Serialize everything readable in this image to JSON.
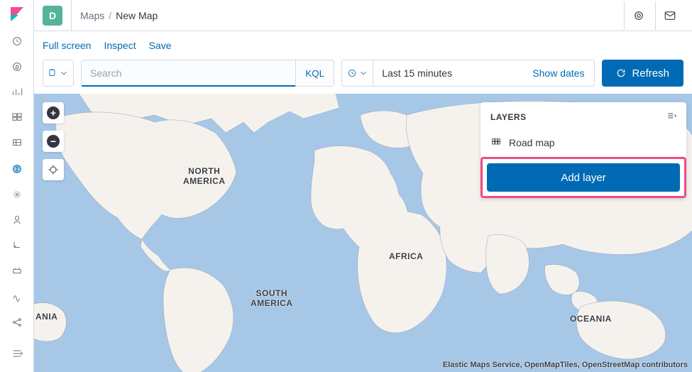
{
  "topbar": {
    "space_letter": "D",
    "breadcrumb_app": "Maps",
    "breadcrumb_current": "New Map"
  },
  "toolbar": {
    "full_screen": "Full screen",
    "inspect": "Inspect",
    "save": "Save"
  },
  "querybar": {
    "search_placeholder": "Search",
    "kql_label": "KQL",
    "date_range": "Last 15 minutes",
    "show_dates": "Show dates",
    "refresh_label": "Refresh"
  },
  "map": {
    "labels": {
      "north_america_1": "NORTH",
      "north_america_2": "AMERICA",
      "south_america_1": "SOUTH",
      "south_america_2": "AMERICA",
      "africa": "AFRICA",
      "oceania": "OCEANIA",
      "ania": "ANIA"
    },
    "attribution": "Elastic Maps Service, OpenMapTiles, OpenStreetMap contributors"
  },
  "layers": {
    "title": "LAYERS",
    "items": [
      {
        "label": "Road map"
      }
    ],
    "add_layer_label": "Add layer"
  }
}
